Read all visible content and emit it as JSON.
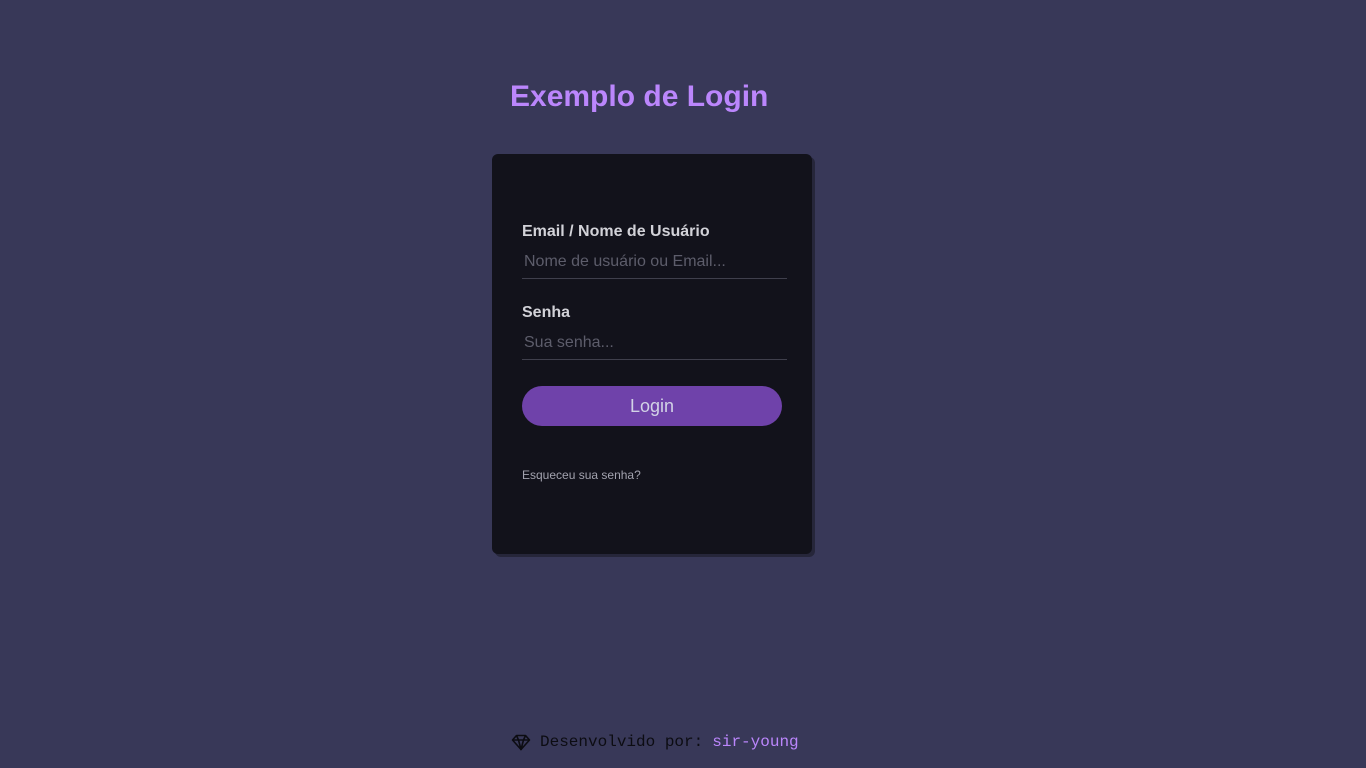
{
  "colors": {
    "background": "#383858",
    "card": "#12121b",
    "accent": "#bb86fc",
    "button": "#6f42aa",
    "button_text": "#d2d2e6"
  },
  "page": {
    "title": "Exemplo de Login"
  },
  "form": {
    "email": {
      "label": "Email / Nome de Usuário",
      "placeholder": "Nome de usuário ou Email...",
      "value": ""
    },
    "password": {
      "label": "Senha",
      "placeholder": "Sua senha...",
      "value": ""
    },
    "login_label": "Login",
    "forgot_label": "Esqueceu sua senha?"
  },
  "footer": {
    "icon": "gem-icon",
    "prefix": "Desenvolvido por:",
    "author": "sir-young"
  }
}
